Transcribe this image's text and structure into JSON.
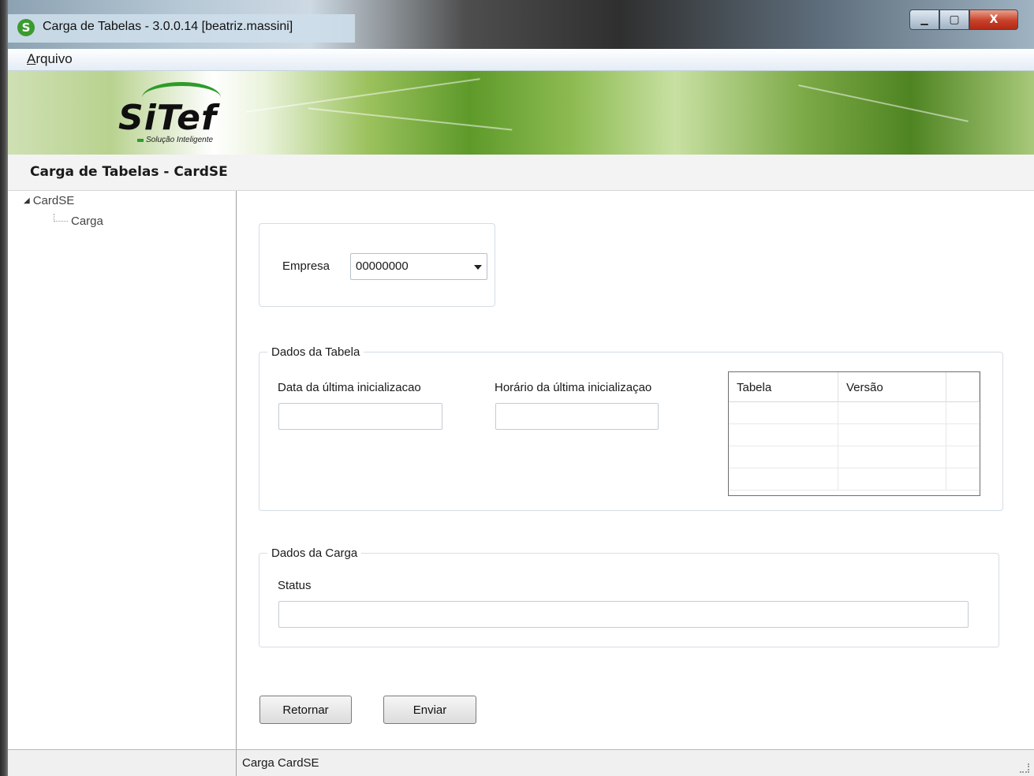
{
  "window": {
    "app_icon_letter": "S",
    "title": "Carga de Tabelas - 3.0.0.14  [beatriz.massini]",
    "controls": {
      "minimize": "▁",
      "maximize": "▢",
      "close": "X"
    }
  },
  "menu": {
    "arquivo_first": "A",
    "arquivo_rest": "rquivo"
  },
  "banner": {
    "logo": "SiTef",
    "tagline": "Solução Inteligente"
  },
  "header": {
    "title": "Carga de Tabelas - CardSE"
  },
  "tree": {
    "root": "CardSE",
    "child": "Carga",
    "expand_glyph": "◢"
  },
  "empresa": {
    "label": "Empresa",
    "selected": "00000000"
  },
  "dados_tabela": {
    "legend": "Dados da Tabela",
    "data_label": "Data da última inicializacao",
    "data_value": "",
    "horario_label": "Horário da última inicializaçao",
    "horario_value": "",
    "columns": [
      "Tabela",
      "Versão",
      ""
    ]
  },
  "dados_carga": {
    "legend": "Dados da Carga",
    "status_label": "Status",
    "status_value": ""
  },
  "buttons": {
    "retornar": "Retornar",
    "enviar": "Enviar"
  },
  "statusbar": {
    "text": "Carga CardSE"
  }
}
